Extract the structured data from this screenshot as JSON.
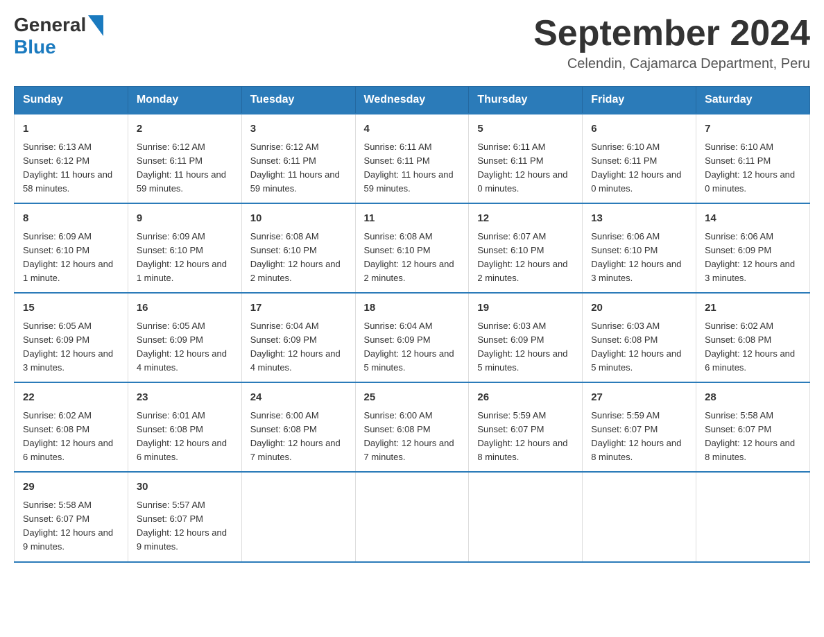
{
  "header": {
    "logo": {
      "general": "General",
      "blue": "Blue"
    },
    "title": "September 2024",
    "location": "Celendin, Cajamarca Department, Peru"
  },
  "weekdays": [
    "Sunday",
    "Monday",
    "Tuesday",
    "Wednesday",
    "Thursday",
    "Friday",
    "Saturday"
  ],
  "weeks": [
    [
      {
        "day": "1",
        "sunrise": "Sunrise: 6:13 AM",
        "sunset": "Sunset: 6:12 PM",
        "daylight": "Daylight: 11 hours and 58 minutes."
      },
      {
        "day": "2",
        "sunrise": "Sunrise: 6:12 AM",
        "sunset": "Sunset: 6:11 PM",
        "daylight": "Daylight: 11 hours and 59 minutes."
      },
      {
        "day": "3",
        "sunrise": "Sunrise: 6:12 AM",
        "sunset": "Sunset: 6:11 PM",
        "daylight": "Daylight: 11 hours and 59 minutes."
      },
      {
        "day": "4",
        "sunrise": "Sunrise: 6:11 AM",
        "sunset": "Sunset: 6:11 PM",
        "daylight": "Daylight: 11 hours and 59 minutes."
      },
      {
        "day": "5",
        "sunrise": "Sunrise: 6:11 AM",
        "sunset": "Sunset: 6:11 PM",
        "daylight": "Daylight: 12 hours and 0 minutes."
      },
      {
        "day": "6",
        "sunrise": "Sunrise: 6:10 AM",
        "sunset": "Sunset: 6:11 PM",
        "daylight": "Daylight: 12 hours and 0 minutes."
      },
      {
        "day": "7",
        "sunrise": "Sunrise: 6:10 AM",
        "sunset": "Sunset: 6:11 PM",
        "daylight": "Daylight: 12 hours and 0 minutes."
      }
    ],
    [
      {
        "day": "8",
        "sunrise": "Sunrise: 6:09 AM",
        "sunset": "Sunset: 6:10 PM",
        "daylight": "Daylight: 12 hours and 1 minute."
      },
      {
        "day": "9",
        "sunrise": "Sunrise: 6:09 AM",
        "sunset": "Sunset: 6:10 PM",
        "daylight": "Daylight: 12 hours and 1 minute."
      },
      {
        "day": "10",
        "sunrise": "Sunrise: 6:08 AM",
        "sunset": "Sunset: 6:10 PM",
        "daylight": "Daylight: 12 hours and 2 minutes."
      },
      {
        "day": "11",
        "sunrise": "Sunrise: 6:08 AM",
        "sunset": "Sunset: 6:10 PM",
        "daylight": "Daylight: 12 hours and 2 minutes."
      },
      {
        "day": "12",
        "sunrise": "Sunrise: 6:07 AM",
        "sunset": "Sunset: 6:10 PM",
        "daylight": "Daylight: 12 hours and 2 minutes."
      },
      {
        "day": "13",
        "sunrise": "Sunrise: 6:06 AM",
        "sunset": "Sunset: 6:10 PM",
        "daylight": "Daylight: 12 hours and 3 minutes."
      },
      {
        "day": "14",
        "sunrise": "Sunrise: 6:06 AM",
        "sunset": "Sunset: 6:09 PM",
        "daylight": "Daylight: 12 hours and 3 minutes."
      }
    ],
    [
      {
        "day": "15",
        "sunrise": "Sunrise: 6:05 AM",
        "sunset": "Sunset: 6:09 PM",
        "daylight": "Daylight: 12 hours and 3 minutes."
      },
      {
        "day": "16",
        "sunrise": "Sunrise: 6:05 AM",
        "sunset": "Sunset: 6:09 PM",
        "daylight": "Daylight: 12 hours and 4 minutes."
      },
      {
        "day": "17",
        "sunrise": "Sunrise: 6:04 AM",
        "sunset": "Sunset: 6:09 PM",
        "daylight": "Daylight: 12 hours and 4 minutes."
      },
      {
        "day": "18",
        "sunrise": "Sunrise: 6:04 AM",
        "sunset": "Sunset: 6:09 PM",
        "daylight": "Daylight: 12 hours and 5 minutes."
      },
      {
        "day": "19",
        "sunrise": "Sunrise: 6:03 AM",
        "sunset": "Sunset: 6:09 PM",
        "daylight": "Daylight: 12 hours and 5 minutes."
      },
      {
        "day": "20",
        "sunrise": "Sunrise: 6:03 AM",
        "sunset": "Sunset: 6:08 PM",
        "daylight": "Daylight: 12 hours and 5 minutes."
      },
      {
        "day": "21",
        "sunrise": "Sunrise: 6:02 AM",
        "sunset": "Sunset: 6:08 PM",
        "daylight": "Daylight: 12 hours and 6 minutes."
      }
    ],
    [
      {
        "day": "22",
        "sunrise": "Sunrise: 6:02 AM",
        "sunset": "Sunset: 6:08 PM",
        "daylight": "Daylight: 12 hours and 6 minutes."
      },
      {
        "day": "23",
        "sunrise": "Sunrise: 6:01 AM",
        "sunset": "Sunset: 6:08 PM",
        "daylight": "Daylight: 12 hours and 6 minutes."
      },
      {
        "day": "24",
        "sunrise": "Sunrise: 6:00 AM",
        "sunset": "Sunset: 6:08 PM",
        "daylight": "Daylight: 12 hours and 7 minutes."
      },
      {
        "day": "25",
        "sunrise": "Sunrise: 6:00 AM",
        "sunset": "Sunset: 6:08 PM",
        "daylight": "Daylight: 12 hours and 7 minutes."
      },
      {
        "day": "26",
        "sunrise": "Sunrise: 5:59 AM",
        "sunset": "Sunset: 6:07 PM",
        "daylight": "Daylight: 12 hours and 8 minutes."
      },
      {
        "day": "27",
        "sunrise": "Sunrise: 5:59 AM",
        "sunset": "Sunset: 6:07 PM",
        "daylight": "Daylight: 12 hours and 8 minutes."
      },
      {
        "day": "28",
        "sunrise": "Sunrise: 5:58 AM",
        "sunset": "Sunset: 6:07 PM",
        "daylight": "Daylight: 12 hours and 8 minutes."
      }
    ],
    [
      {
        "day": "29",
        "sunrise": "Sunrise: 5:58 AM",
        "sunset": "Sunset: 6:07 PM",
        "daylight": "Daylight: 12 hours and 9 minutes."
      },
      {
        "day": "30",
        "sunrise": "Sunrise: 5:57 AM",
        "sunset": "Sunset: 6:07 PM",
        "daylight": "Daylight: 12 hours and 9 minutes."
      },
      null,
      null,
      null,
      null,
      null
    ]
  ]
}
